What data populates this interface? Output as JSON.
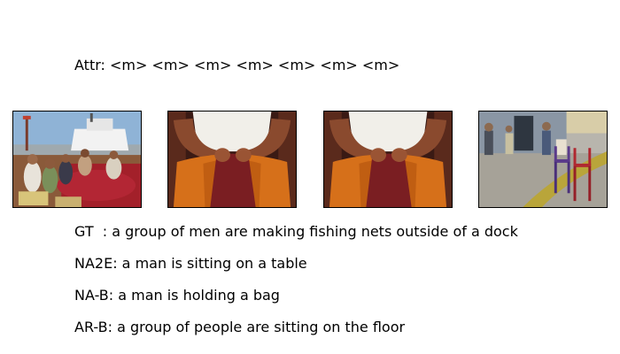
{
  "attr_line": "Attr: <m> <m> <m> <m> <m> <m> <m>",
  "captions": {
    "gt": "GT  : a group of men are making fishing nets outside of a dock",
    "na2e": "NA2E: a man is sitting on a table",
    "na_b": "NA-B: a man is holding a bag",
    "ar_b": "AR-B: a group of people are sitting on the floor"
  },
  "frames": [
    "dock-fishermen-frame",
    "hands-net-closeup-frame",
    "hands-net-closeup-frame-2",
    "courtyard-chairs-frame"
  ]
}
